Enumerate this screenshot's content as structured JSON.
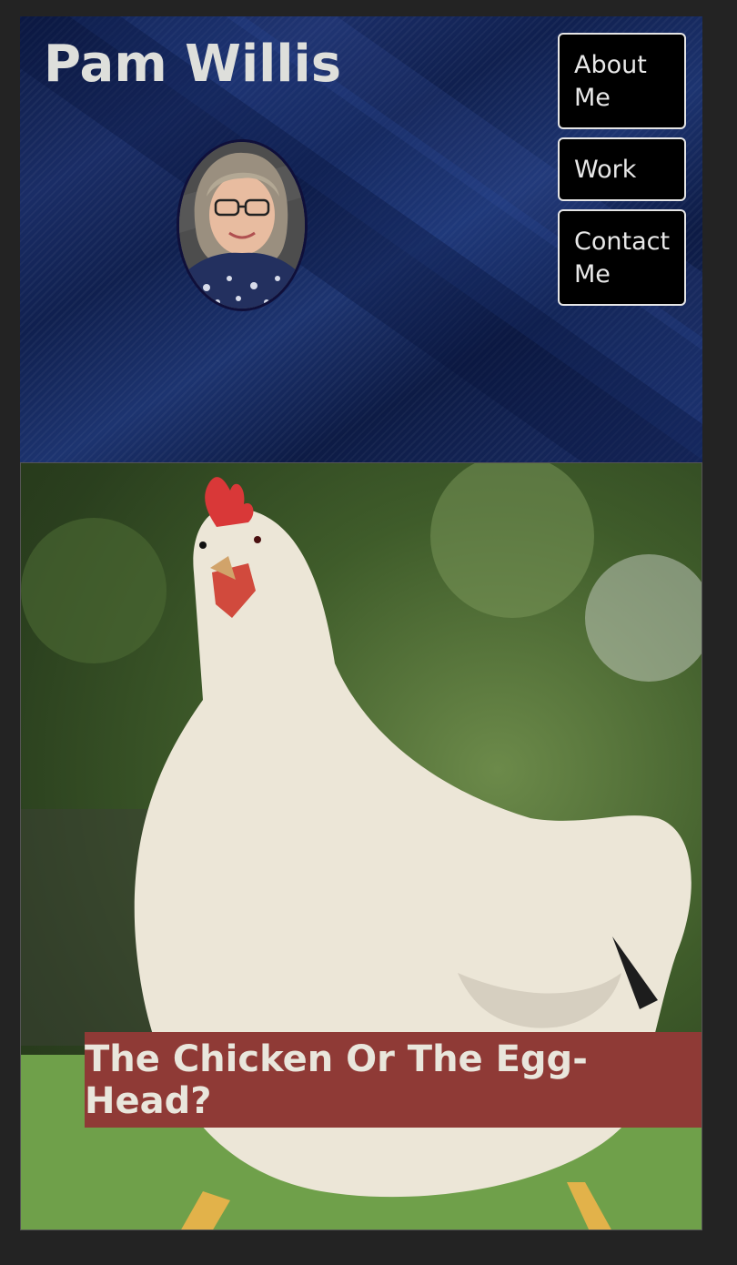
{
  "header": {
    "title": "Pam Willis"
  },
  "nav": {
    "items": [
      {
        "label": "About Me"
      },
      {
        "label": "Work"
      },
      {
        "label": "Contact Me"
      }
    ]
  },
  "hero": {
    "caption": "The Chicken Or The Egg-Head?"
  },
  "colors": {
    "page_bg": "#232323",
    "header_bg": "#12214f",
    "nav_bg": "#000000",
    "banner_bg": "#8f3a36",
    "text_light": "#dedfdb"
  }
}
